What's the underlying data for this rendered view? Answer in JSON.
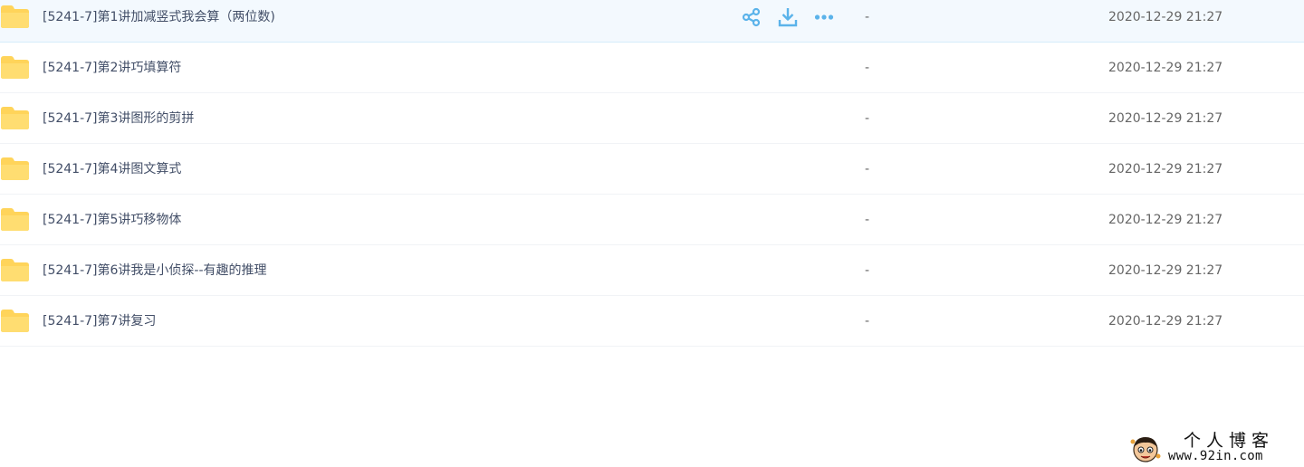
{
  "files": [
    {
      "name": "[5241-7]第1讲加减竖式我会算（两位数)",
      "size": "-",
      "date": "2020-12-29 21:27"
    },
    {
      "name": "[5241-7]第2讲巧填算符",
      "size": "-",
      "date": "2020-12-29 21:27"
    },
    {
      "name": "[5241-7]第3讲图形的剪拼",
      "size": "-",
      "date": "2020-12-29 21:27"
    },
    {
      "name": "[5241-7]第4讲图文算式",
      "size": "-",
      "date": "2020-12-29 21:27"
    },
    {
      "name": "[5241-7]第5讲巧移物体",
      "size": "-",
      "date": "2020-12-29 21:27"
    },
    {
      "name": "[5241-7]第6讲我是小侦探--有趣的推理",
      "size": "-",
      "date": "2020-12-29 21:27"
    },
    {
      "name": "[5241-7]第7讲复习",
      "size": "-",
      "date": "2020-12-29 21:27"
    }
  ],
  "hovered_row_actions": [
    "share-icon",
    "download-icon",
    "more-icon"
  ],
  "icons": {
    "folder": "folder-icon",
    "share": "share-icon",
    "download": "download-icon",
    "more": "more-icon"
  },
  "colors": {
    "accent": "#5bb3ea",
    "folder": "#ffd45a",
    "hover_row": "#f3f9fe",
    "text": "#424e67",
    "meta_text": "#666666"
  },
  "watermark": {
    "title": "个人博客",
    "url": "www.92in.com"
  }
}
